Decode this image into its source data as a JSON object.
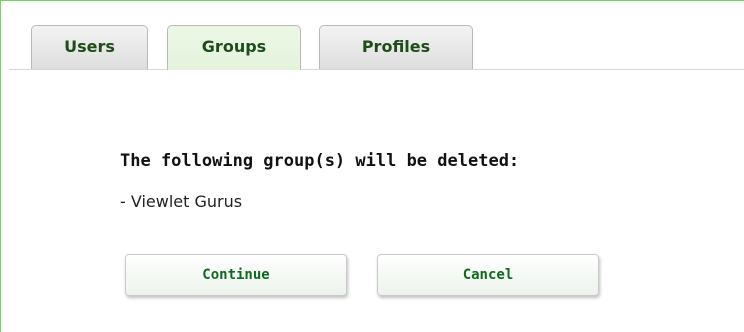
{
  "tabs": [
    {
      "label": "Users",
      "active": false
    },
    {
      "label": "Groups",
      "active": true
    },
    {
      "label": "Profiles",
      "active": false
    }
  ],
  "dialog": {
    "message": "The following group(s) will be deleted:",
    "items": [
      "- Viewlet Gurus"
    ],
    "continue_label": "Continue",
    "cancel_label": "Cancel"
  },
  "colors": {
    "frame_border": "#66dd55",
    "tab_text": "#1e4d1a",
    "active_tab_bg": "#e4f3dc",
    "button_text": "#0d6b1d"
  }
}
